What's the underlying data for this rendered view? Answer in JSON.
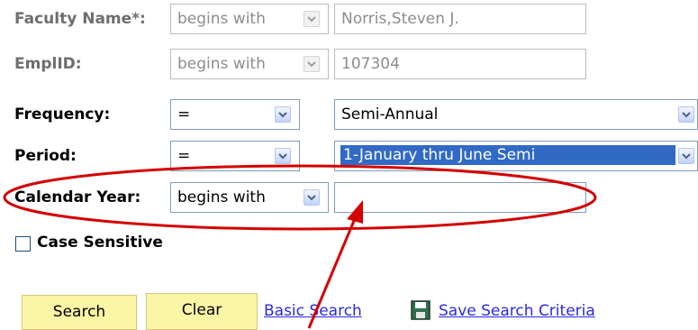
{
  "criteria": {
    "faculty_name": {
      "label": "Faculty Name*:",
      "operator": "begins with",
      "value": "Norris,Steven J."
    },
    "emplid": {
      "label": "EmplID:",
      "operator": "begins with",
      "value": "107304"
    },
    "frequency": {
      "label": "Frequency:",
      "operator": "=",
      "value": "Semi-Annual"
    },
    "period": {
      "label": "Period:",
      "operator": "=",
      "value": "1-January thru June Semi"
    },
    "calendar_year": {
      "label": "Calendar Year:",
      "operator": "begins with",
      "value": ""
    }
  },
  "case_sensitive": {
    "label": "Case Sensitive",
    "checked": false
  },
  "actions": {
    "search_label": "Search",
    "clear_label": "Clear",
    "basic_search_label": "Basic Search",
    "save_criteria_label": "Save Search Criteria"
  },
  "colors": {
    "annotation": "#d40000",
    "link": "#2a2ae0",
    "button_fill": "#fbf5a6",
    "selection": "#316ac5"
  },
  "icons": {
    "dropdown": "chevron-down-icon",
    "save": "floppy-disk-icon"
  }
}
